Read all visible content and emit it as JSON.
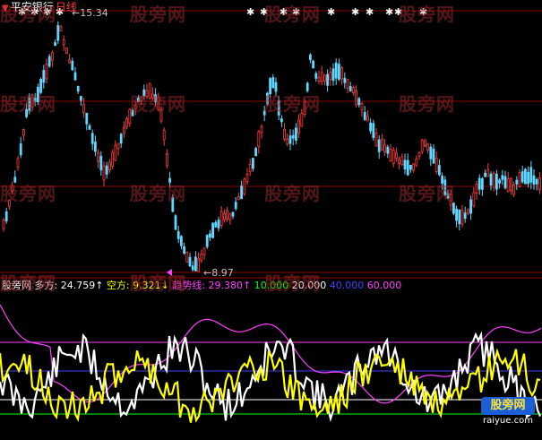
{
  "title": {
    "stock_name": "平安银行",
    "period": "日线"
  },
  "price_labels": {
    "high": "15.34",
    "low": "8.97"
  },
  "indicator": {
    "name": "股旁网",
    "items": [
      {
        "text": "多方: 24.759↑",
        "color": "#ffffff"
      },
      {
        "text": "空方: 9.321↓",
        "color": "#ffff00"
      },
      {
        "text": "趋势线: 29.380↑",
        "color": "#ff40ff"
      },
      {
        "text": "10.000",
        "color": "#00ff00"
      },
      {
        "text": "20.000",
        "color": "#ffffff"
      },
      {
        "text": "40.000",
        "color": "#4040ff"
      },
      {
        "text": "60.000",
        "color": "#ff40ff"
      }
    ]
  },
  "watermark_text": "股旁网",
  "logo": {
    "badge": "股旁网",
    "domain": "raiyue.com"
  },
  "colors": {
    "background": "#000000",
    "up_candle": "#ff3b3b",
    "down_candle": "#5fd7ff",
    "guide_red": "#8b0000",
    "line_bull": "#ffffff",
    "line_bear": "#ffff00",
    "line_trend": "#ff40ff",
    "level_10": "#00ff00",
    "level_20": "#ffffff",
    "level_40": "#4040ff",
    "level_60": "#ff40ff"
  }
}
